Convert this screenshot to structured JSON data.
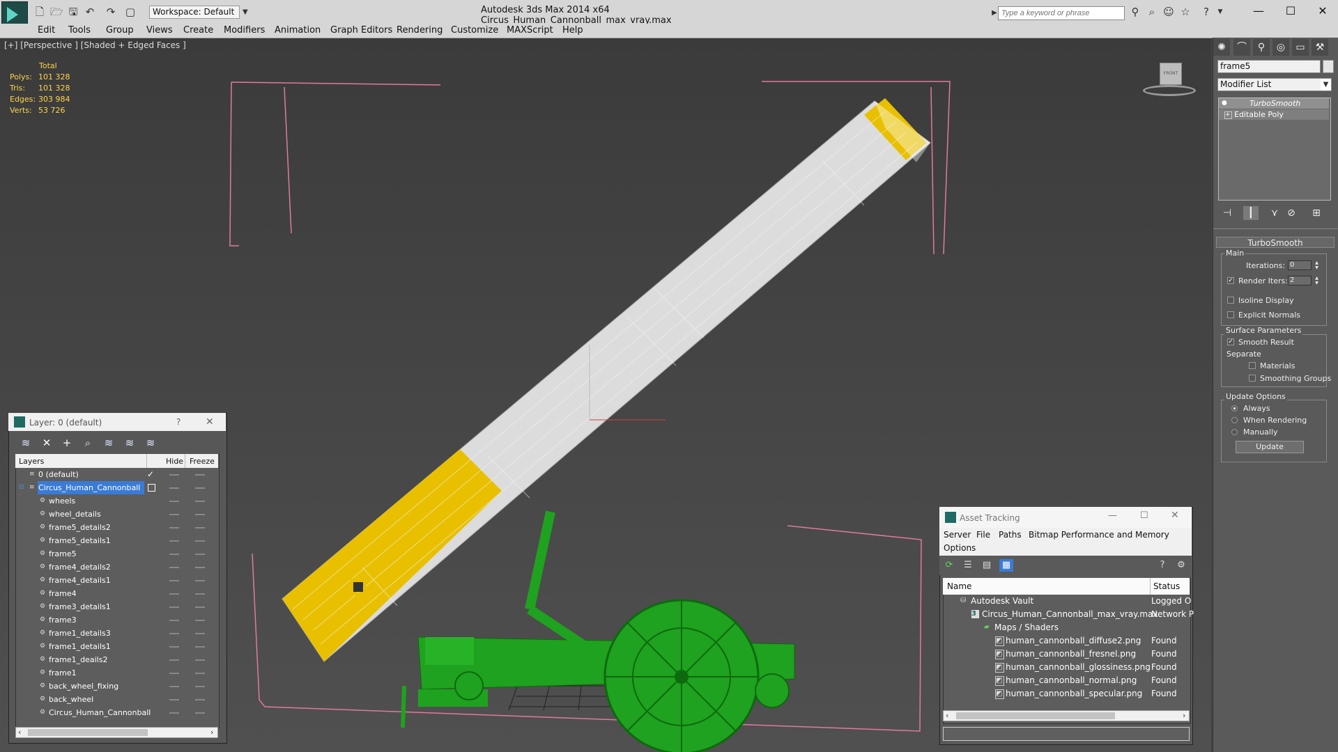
{
  "titlebar": {
    "workspace": "Workspace: Default",
    "app_title": "Autodesk 3ds Max  2014 x64",
    "file_title": "Circus_Human_Cannonball_max_vray.max",
    "search_placeholder": "Type a keyword or phrase",
    "win_minimize": "—",
    "win_maximize": "☐",
    "win_close": "✕"
  },
  "menu": [
    "Edit",
    "Tools",
    "Group",
    "Views",
    "Create",
    "Modifiers",
    "Animation",
    "Graph Editors",
    "Rendering",
    "Customize",
    "MAXScript",
    "Help"
  ],
  "viewport": {
    "label": "[+] [Perspective ] [Shaded + Edged Faces ]",
    "stats_header": "Total",
    "stats": [
      {
        "label": "Polys:",
        "value": "101 328"
      },
      {
        "label": "Tris:",
        "value": "101 328"
      },
      {
        "label": "Edges:",
        "value": "303 984"
      },
      {
        "label": "Verts:",
        "value": "53 726"
      }
    ],
    "viewcube_label": "FRONT"
  },
  "command_panel": {
    "object_name": "frame5",
    "modifier_list": "Modifier List",
    "stack": [
      "TurboSmooth",
      "Editable Poly"
    ],
    "rollout_title": "TurboSmooth",
    "main_group": "Main",
    "iterations_label": "Iterations:",
    "iterations_value": "0",
    "render_iters_label": "Render Iters:",
    "render_iters_value": "2",
    "isoline_label": "Isoline Display",
    "explicit_label": "Explicit Normals",
    "surface_group": "Surface Parameters",
    "smooth_result_label": "Smooth Result",
    "separate_label": "Separate",
    "materials_label": "Materials",
    "smoothing_groups_label": "Smoothing Groups",
    "update_group": "Update Options",
    "update_always": "Always",
    "update_rendering": "When Rendering",
    "update_manually": "Manually",
    "update_button": "Update"
  },
  "layer_dialog": {
    "title": "Layer: 0 (default)",
    "help": "?",
    "close": "✕",
    "columns": [
      "Layers",
      "Hide",
      "Freeze"
    ],
    "rows": [
      {
        "name": "0 (default)",
        "level": 0,
        "current": true
      },
      {
        "name": "Circus_Human_Cannonball",
        "level": 0,
        "selected": true
      },
      {
        "name": "wheels",
        "level": 1
      },
      {
        "name": "wheel_details",
        "level": 1
      },
      {
        "name": "frame5_details2",
        "level": 1
      },
      {
        "name": "frame5_details1",
        "level": 1
      },
      {
        "name": "frame5",
        "level": 1
      },
      {
        "name": "frame4_details2",
        "level": 1
      },
      {
        "name": "frame4_details1",
        "level": 1
      },
      {
        "name": "frame4",
        "level": 1
      },
      {
        "name": "frame3_details1",
        "level": 1
      },
      {
        "name": "frame3",
        "level": 1
      },
      {
        "name": "frame1_details3",
        "level": 1
      },
      {
        "name": "frame1_details1",
        "level": 1
      },
      {
        "name": "frame1_deails2",
        "level": 1
      },
      {
        "name": "frame1",
        "level": 1
      },
      {
        "name": "back_wheel_fixing",
        "level": 1
      },
      {
        "name": "back_wheel",
        "level": 1
      },
      {
        "name": "Circus_Human_Cannonball",
        "level": 1
      }
    ]
  },
  "asset_dialog": {
    "title": "Asset Tracking",
    "menu": [
      "Server",
      "File",
      "Paths",
      "Bitmap Performance and Memory",
      "Options"
    ],
    "columns": [
      "Name",
      "Status"
    ],
    "rows": [
      {
        "name": "Autodesk Vault",
        "status": "Logged O",
        "level": 0
      },
      {
        "name": "Circus_Human_Cannonball_max_vray.max",
        "status": "Network P",
        "level": 1
      },
      {
        "name": "Maps / Shaders",
        "status": "",
        "level": 2
      },
      {
        "name": "human_cannonball_diffuse2.png",
        "status": "Found",
        "level": 3
      },
      {
        "name": "human_cannonball_fresnel.png",
        "status": "Found",
        "level": 3
      },
      {
        "name": "human_cannonball_glossiness.png",
        "status": "Found",
        "level": 3
      },
      {
        "name": "human_cannonball_normal.png",
        "status": "Found",
        "level": 3
      },
      {
        "name": "human_cannonball_specular.png",
        "status": "Found",
        "level": 3
      }
    ]
  },
  "colors": {
    "barrel_yellow": "#e8c000",
    "barrel_white": "#dcdcdc",
    "frame_green": "#1fa21f",
    "selection_pink": "#e07aa0",
    "stats_yellow": "#ffd54a",
    "selected_row": "#3a7bd5"
  }
}
